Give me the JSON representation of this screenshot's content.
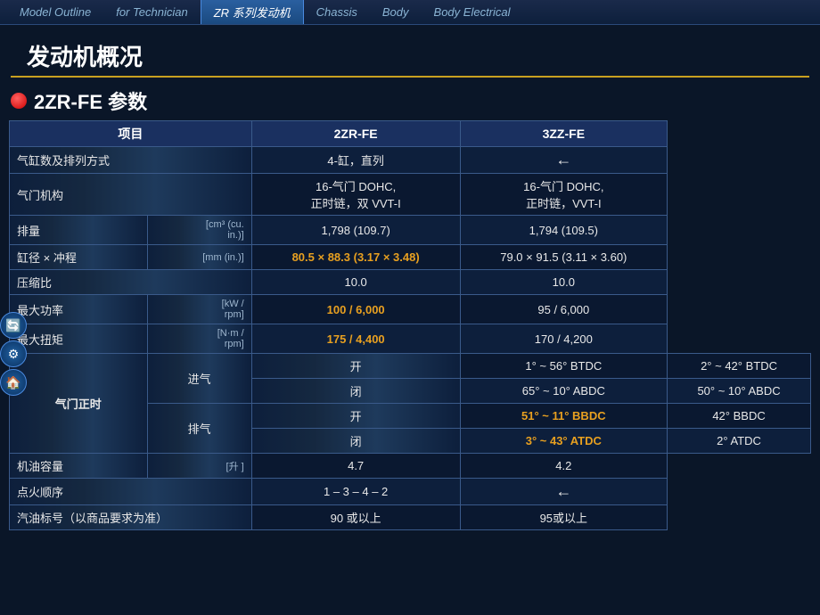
{
  "nav": {
    "items": [
      {
        "label": "Model Outline",
        "active": false
      },
      {
        "label": "for Technician",
        "active": false
      },
      {
        "label": "ZR 系列发动机",
        "active": true
      },
      {
        "label": "Chassis",
        "active": false
      },
      {
        "label": "Body",
        "active": false
      },
      {
        "label": "Body Electrical",
        "active": false
      }
    ]
  },
  "page_title": "发动机概况",
  "section_title": "2ZR-FE 参数",
  "table": {
    "headers": [
      "项目",
      "2ZR-FE",
      "3ZZ-FE"
    ],
    "rows": [
      {
        "label": "气缸数及排列方式",
        "col1": "4-缸，直列",
        "col2": "←",
        "highlight1": false,
        "highlight2": false
      },
      {
        "label": "气门机构",
        "col1": "16-气门 DOHC,\n正时链，双 VVT-I",
        "col2": "16-气门 DOHC,\n正时链，VVT-I",
        "highlight1": false,
        "highlight2": false
      },
      {
        "label": "排量",
        "unit": "[cm³ (cu.\nin.)]",
        "col1": "1,798 (109.7)",
        "col2": "1,794 (109.5)",
        "highlight1": false,
        "highlight2": false
      },
      {
        "label": "缸径 × 冲程",
        "unit": "[mm (in.)]",
        "col1": "80.5 × 88.3 (3.17 × 3.48)",
        "col2": "79.0 × 91.5 (3.11 × 3.60)",
        "highlight1": true,
        "highlight2": false
      },
      {
        "label": "压缩比",
        "col1": "10.0",
        "col2": "10.0",
        "highlight1": false,
        "highlight2": false
      },
      {
        "label": "最大功率",
        "unit": "[kW /\nrpm]",
        "col1": "100 / 6,000",
        "col2": "95 / 6,000",
        "highlight1": true,
        "highlight2": false
      },
      {
        "label": "最大扭矩",
        "unit": "[N·m /\nrpm]",
        "col1": "175 / 4,400",
        "col2": "170 / 4,200",
        "highlight1": true,
        "highlight2": false
      }
    ],
    "valve_timing": {
      "section_label": "气门正时",
      "intake_label": "进气",
      "exhaust_label": "排气",
      "open_label": "开",
      "close_label": "闭",
      "rows": [
        {
          "type": "intake",
          "state": "open",
          "col1": "1° ~ 56° BTDC",
          "col2": "2° ~ 42° BTDC",
          "h1": false,
          "h2": false
        },
        {
          "type": "intake",
          "state": "close",
          "col1": "65° ~ 10° ABDC",
          "col2": "50° ~ 10° ABDC",
          "h1": false,
          "h2": false
        },
        {
          "type": "exhaust",
          "state": "open",
          "col1": "51° ~ 11° BBDC",
          "col2": "42° BBDC",
          "h1": true,
          "h2": false
        },
        {
          "type": "exhaust",
          "state": "close",
          "col1": "3° ~ 43° ATDC",
          "col2": "2° ATDC",
          "h1": true,
          "h2": false
        }
      ]
    },
    "bottom_rows": [
      {
        "label": "机油容量",
        "unit": "[升\n]",
        "col1": "4.7",
        "col2": "4.2",
        "h1": false,
        "h2": false
      },
      {
        "label": "点火顺序",
        "col1": "1 – 3 – 4 – 2",
        "col2": "←",
        "h1": false,
        "h2": false
      },
      {
        "label": "汽油标号（以商品要求为准）",
        "col1": "90 或以上",
        "col2": "95或以上",
        "h1": false,
        "h2": false
      }
    ]
  },
  "sidebar_icons": [
    "🔄",
    "⚙",
    "🏠"
  ]
}
